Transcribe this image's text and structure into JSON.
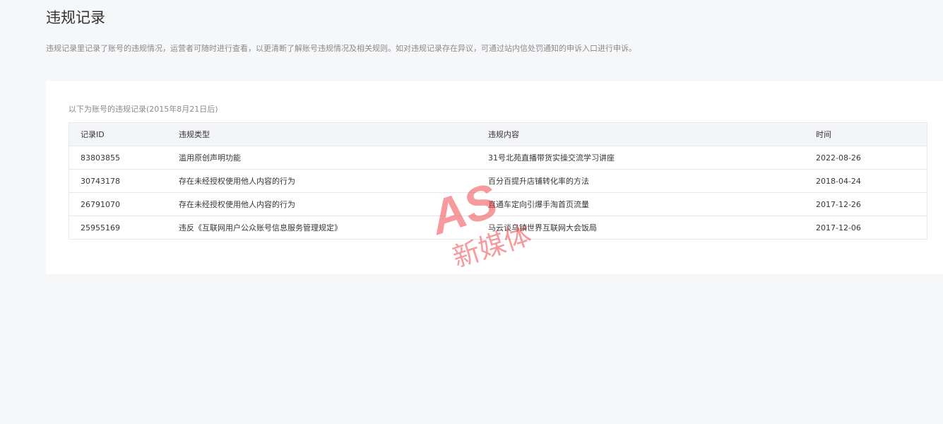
{
  "page": {
    "title": "违规记录",
    "description": "违规记录里记录了账号的违规情况，运营者可随时进行查看，以更清断了解账号违规情况及相关规则。如对违规记录存在异议，可通过站内信处罚通知的申诉入口进行申诉。"
  },
  "panel": {
    "caption": "以下为账号的违规记录(2015年8月21日后)"
  },
  "table": {
    "headers": {
      "id": "记录ID",
      "type": "违规类型",
      "content": "违规内容",
      "time": "时间"
    },
    "rows": [
      {
        "id": "83803855",
        "type": "滥用原创声明功能",
        "content": "31号北苑直播带货实操交流学习讲座",
        "time": "2022-08-26"
      },
      {
        "id": "30743178",
        "type": "存在未经授权使用他人内容的行为",
        "content": "百分百提升店铺转化率的方法",
        "time": "2018-04-24"
      },
      {
        "id": "26791070",
        "type": "存在未经授权使用他人内容的行为",
        "content": "直通车定向引爆手淘首页流量",
        "time": "2017-12-26"
      },
      {
        "id": "25955169",
        "type": "违反《互联网用户公众账号信息服务管理规定》",
        "content": "马云谈乌镇世界互联网大会饭局",
        "time": "2017-12-06"
      }
    ]
  },
  "watermark": {
    "logo_text": "AS",
    "sub_text": "新媒体",
    "color": "#f0383e"
  }
}
